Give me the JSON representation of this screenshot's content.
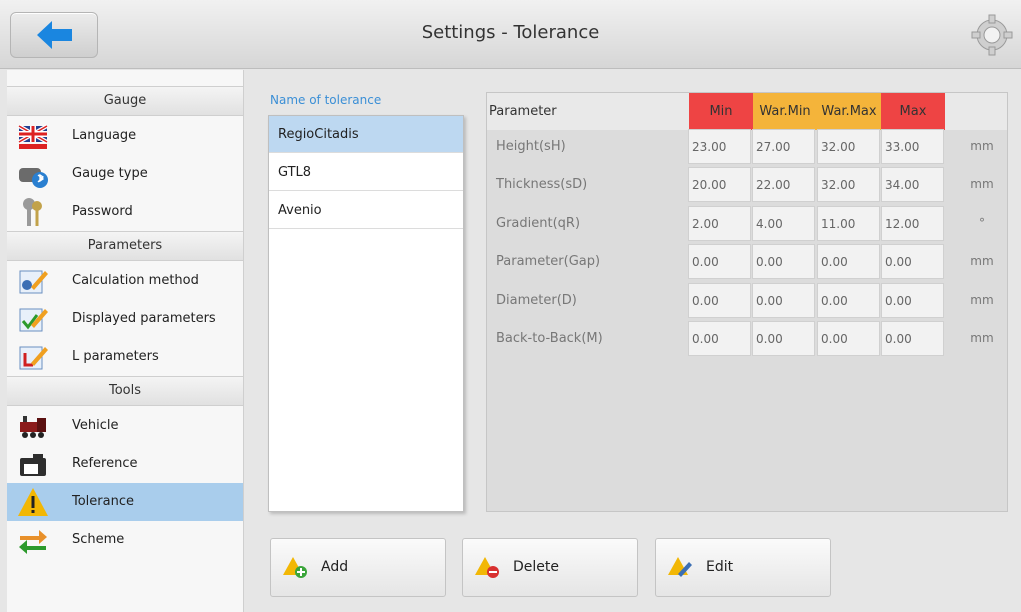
{
  "header": {
    "title": "Settings - Tolerance"
  },
  "sidebar": {
    "sections": {
      "gauge": "Gauge",
      "parameters": "Parameters",
      "tools": "Tools"
    },
    "items": {
      "language": "Language",
      "gauge_type": "Gauge type",
      "password": "Password",
      "calculation_method": "Calculation method",
      "displayed_parameters": "Displayed parameters",
      "l_parameters": "L parameters",
      "vehicle": "Vehicle",
      "reference": "Reference",
      "tolerance": "Tolerance",
      "scheme": "Scheme"
    }
  },
  "tolerance_list": {
    "title": "Name of tolerance",
    "items": [
      "RegioCitadis",
      "GTL8",
      "Avenio"
    ],
    "selected": "RegioCitadis"
  },
  "table": {
    "headers": {
      "parameter": "Parameter",
      "min": "Min",
      "war_min": "War.Min",
      "war_max": "War.Max",
      "max": "Max"
    },
    "header_colors": {
      "min": "#ee4444",
      "war_min": "#f4b43a",
      "war_max": "#f4b43a",
      "max": "#ee4444"
    },
    "rows": [
      {
        "label": "Height(sH)",
        "min": "23.00",
        "war_min": "27.00",
        "war_max": "32.00",
        "max": "33.00",
        "unit": "mm"
      },
      {
        "label": "Thickness(sD)",
        "min": "20.00",
        "war_min": "22.00",
        "war_max": "32.00",
        "max": "34.00",
        "unit": "mm"
      },
      {
        "label": "Gradient(qR)",
        "min": "2.00",
        "war_min": "4.00",
        "war_max": "11.00",
        "max": "12.00",
        "unit": "°"
      },
      {
        "label": "Parameter(Gap)",
        "min": "0.00",
        "war_min": "0.00",
        "war_max": "0.00",
        "max": "0.00",
        "unit": "mm"
      },
      {
        "label": "Diameter(D)",
        "min": "0.00",
        "war_min": "0.00",
        "war_max": "0.00",
        "max": "0.00",
        "unit": "mm"
      },
      {
        "label": "Back-to-Back(M)",
        "min": "0.00",
        "war_min": "0.00",
        "war_max": "0.00",
        "max": "0.00",
        "unit": "mm"
      }
    ]
  },
  "actions": {
    "add": "Add",
    "delete": "Delete",
    "edit": "Edit"
  },
  "icons": {
    "back": "arrow-left-icon",
    "settings": "gear-icon",
    "language": "uk-flag-icon",
    "gauge_type": "gauge-bluetooth-icon",
    "password": "keys-icon",
    "calculation_method": "calc-edit-icon",
    "displayed_parameters": "check-edit-icon",
    "l_parameters": "l-edit-icon",
    "vehicle": "locomotive-icon",
    "reference": "camera-icon",
    "tolerance": "warning-icon",
    "scheme": "swap-arrows-icon"
  },
  "colors": {
    "selected_row": "#a9cdec",
    "list_title": "#3b8fd6",
    "accent_blue": "#1a86e0"
  }
}
